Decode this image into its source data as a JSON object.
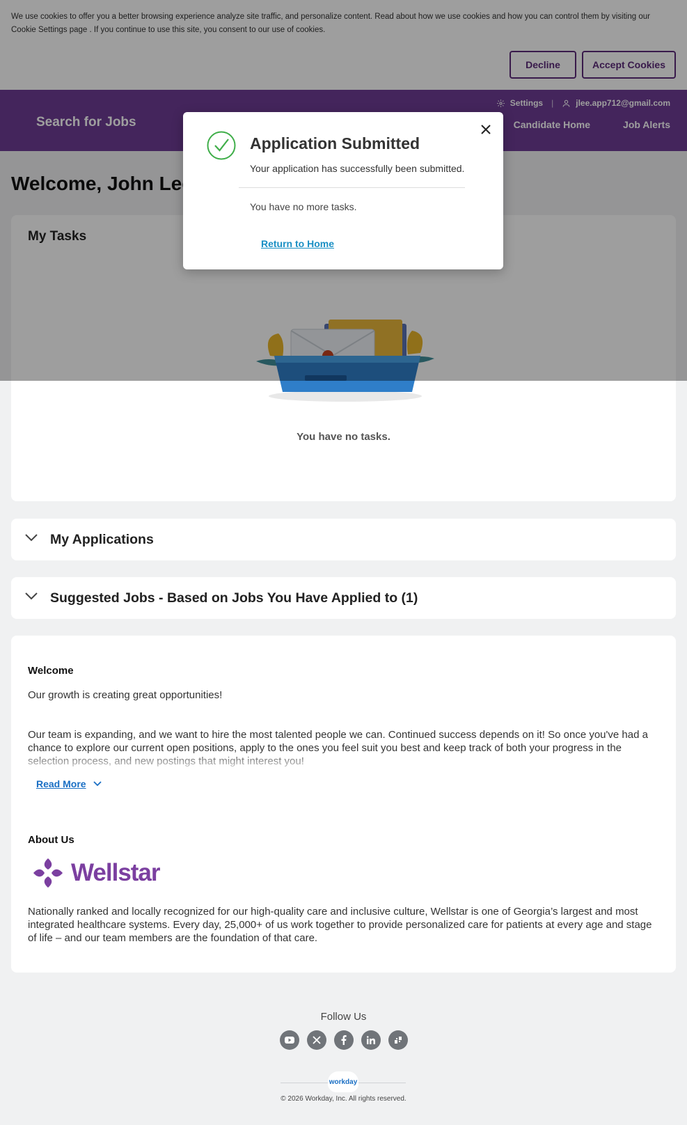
{
  "cookie_banner": {
    "text": "We use cookies to offer you a better browsing experience analyze site traffic, and personalize content.   Read about how we use cookies and how you can control them by visiting our Cookie Settings page .  If you continue to use this site, you consent to our use of cookies.",
    "decline_label": "Decline",
    "accept_label": "Accept Cookies"
  },
  "header": {
    "brand": "Search for Jobs",
    "settings_label": "Settings",
    "user_email": "jlee.app712@gmail.com",
    "nav": [
      "Candidate Home",
      "Job Alerts"
    ],
    "color": "#6e3d95"
  },
  "page": {
    "welcome_title": "Welcome, John Lee"
  },
  "tasks": {
    "title": "My Tasks",
    "empty_text": "You have no tasks."
  },
  "applications": {
    "title": "My Applications"
  },
  "suggested": {
    "title": "Suggested Jobs - Based on Jobs You Have Applied to (1)"
  },
  "welcome_section": {
    "heading": "Welcome",
    "tagline": "Our growth is creating great opportunities!",
    "body": "Our team is expanding, and we want to hire the most talented people we can. Continued success depends on it! So once you've had a chance to explore our current open positions, apply to the ones you feel suit you best and keep track of both your progress in the selection process, and new postings that might interest you!",
    "read_more": "Read More"
  },
  "about_section": {
    "heading": "About Us",
    "logo_text": "Wellstar",
    "body": "Nationally ranked and locally recognized for our high-quality care and inclusive culture, Wellstar is one of Georgia’s largest and most integrated healthcare systems. Every day, 25,000+ of us work together to provide personalized care for patients at every age and stage of life – and our team members are the foundation of that care."
  },
  "footer": {
    "follow_label": "Follow Us",
    "socials": [
      "youtube-icon",
      "x-icon",
      "facebook-icon",
      "linkedin-icon",
      "glassdoor-icon"
    ],
    "workday_label": "workday",
    "copyright": "© 2026 Workday, Inc. All rights reserved."
  },
  "modal": {
    "title": "Application Submitted",
    "subtitle": "Your application has successfully been submitted.",
    "tasks_text": "You have no more tasks.",
    "link_label": "Return to Home",
    "accent_color": "#3fae49"
  }
}
